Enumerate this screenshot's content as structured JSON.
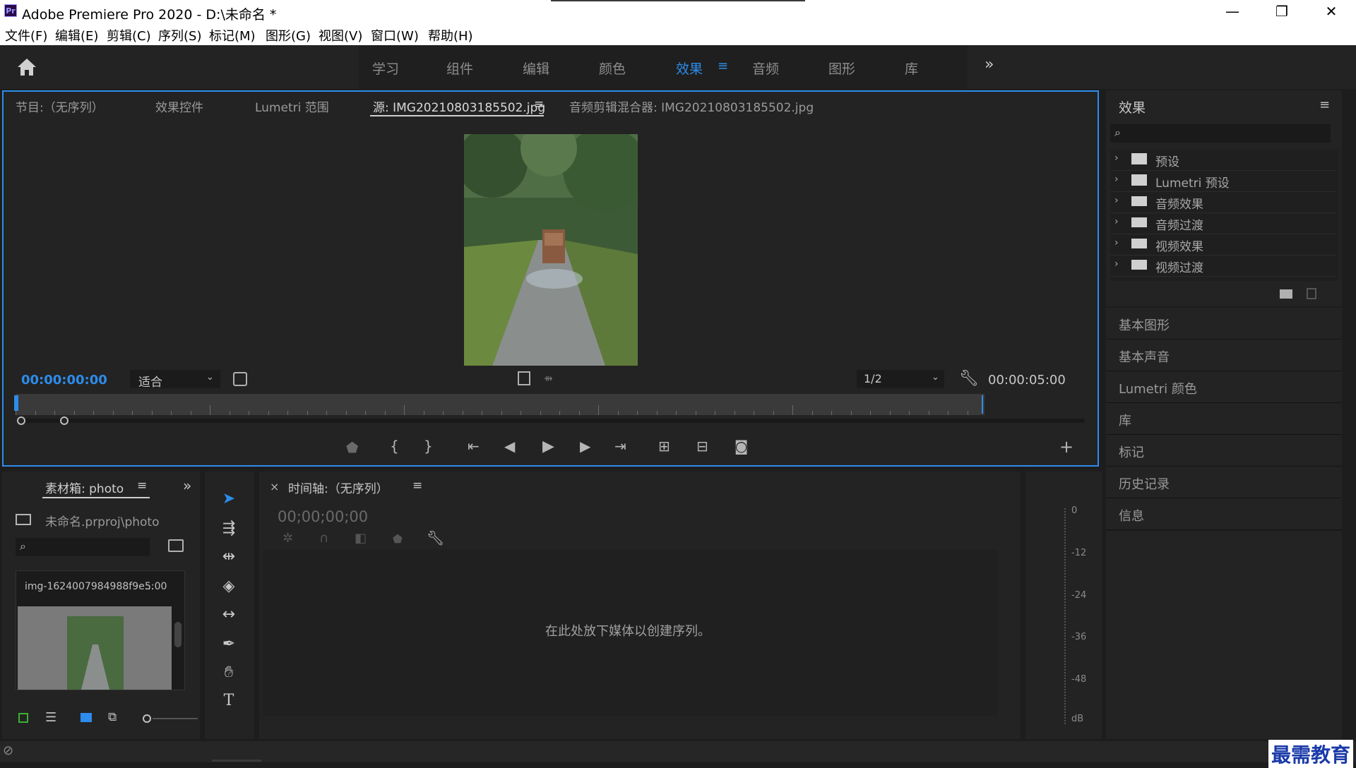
{
  "window": {
    "app_icon": "Pr",
    "title": "Adobe Premiere Pro 2020 - D:\\未命名 *",
    "controls": {
      "minimize": "—",
      "restore": "❐",
      "close": "✕"
    }
  },
  "menu": [
    "文件(F)",
    "编辑(E)",
    "剪辑(C)",
    "序列(S)",
    "标记(M)",
    "图形(G)",
    "视图(V)",
    "窗口(W)",
    "帮助(H)"
  ],
  "workspaces": {
    "items": [
      "学习",
      "组件",
      "编辑",
      "颜色",
      "效果",
      "音频",
      "图形",
      "库"
    ],
    "active": "效果",
    "more": "»"
  },
  "source_panel": {
    "tabs": [
      "节目:（无序列）",
      "效果控件",
      "Lumetri 范围",
      "源: IMG20210803185502.jpg",
      "音频剪辑混合器: IMG20210803185502.jpg"
    ],
    "timecode_current": "00:00:00:00",
    "fit_select": "适合",
    "resolution_select": "1/2",
    "timecode_duration": "00:00:05:00"
  },
  "effects_panel": {
    "title": "效果",
    "items": [
      "预设",
      "Lumetri 预设",
      "音频效果",
      "音频过渡",
      "视频效果",
      "视频过渡"
    ]
  },
  "right_sections": [
    "基本图形",
    "基本声音",
    "Lumetri 颜色",
    "库",
    "标记",
    "历史记录",
    "信息"
  ],
  "bin_panel": {
    "tab": "素材箱: photo",
    "path": "未命名.prproj\\photo",
    "clip_name": "img-1624007984988f9e...",
    "clip_duration": "5:00"
  },
  "timeline_panel": {
    "close": "×",
    "tab": "时间轴:（无序列）",
    "timecode": "00;00;00;00",
    "drop_hint": "在此处放下媒体以创建序列。"
  },
  "audio_meter": {
    "labels": [
      "0",
      "-12",
      "-24",
      "-36",
      "-48",
      "dB"
    ]
  },
  "watermark": "最需教育",
  "colors": {
    "accent": "#2d8ceb",
    "panel_bg": "#232323",
    "window_bg": "#1d1d1d",
    "highlight_border": "#2d8ceb"
  }
}
